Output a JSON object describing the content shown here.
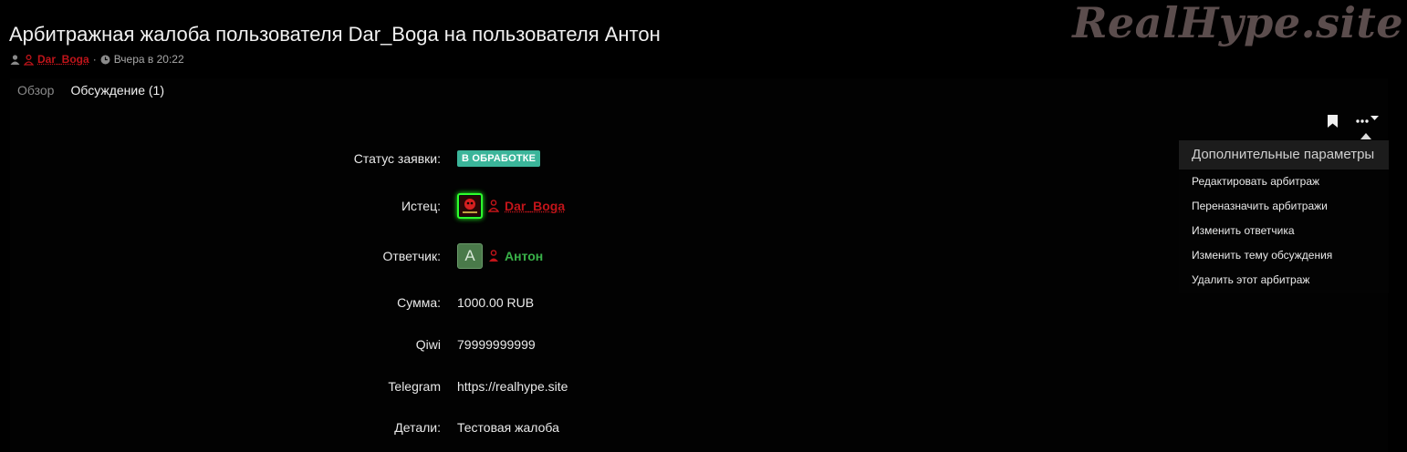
{
  "watermark": "RealHype.site",
  "header": {
    "title": "Арбитражная жалоба пользователя Dar_Boga на пользователя Антон",
    "author": "Dar_Boga",
    "separator": "·",
    "date": "Вчера в 20:22"
  },
  "tabs": [
    {
      "label": "Обзор",
      "active": false
    },
    {
      "label": "Обсуждение (1)",
      "active": true
    }
  ],
  "dropdown": {
    "title": "Дополнительные параметры",
    "items": [
      "Редактировать арбитраж",
      "Переназначить арбитражи",
      "Изменить ответчика",
      "Изменить тему обсуждения",
      "Удалить этот арбитраж"
    ]
  },
  "fields": {
    "status": {
      "label": "Статус заявки:",
      "value": "В ОБРАБОТКЕ"
    },
    "plaintiff": {
      "label": "Истец:",
      "name": "Dar_Boga"
    },
    "defendant": {
      "label": "Ответчик:",
      "name": "Антон",
      "avatar_letter": "А"
    },
    "amount": {
      "label": "Сумма:",
      "value": "1000.00 RUB"
    },
    "qiwi": {
      "label": "Qiwi",
      "value": "79999999999"
    },
    "telegram": {
      "label": "Telegram",
      "value": "https://realhype.site"
    },
    "details": {
      "label": "Детали:",
      "value": "Тестовая жалоба"
    }
  },
  "colors": {
    "background": "#000000",
    "badge": "#3bb59a",
    "plaintiff_name": "#c21419",
    "defendant_name": "#39b249",
    "avatar_glow": "#2dff2d"
  },
  "icons": [
    "user-icon",
    "clock-icon",
    "bookmark-icon",
    "more-dots-icon",
    "chevron-down-icon"
  ]
}
